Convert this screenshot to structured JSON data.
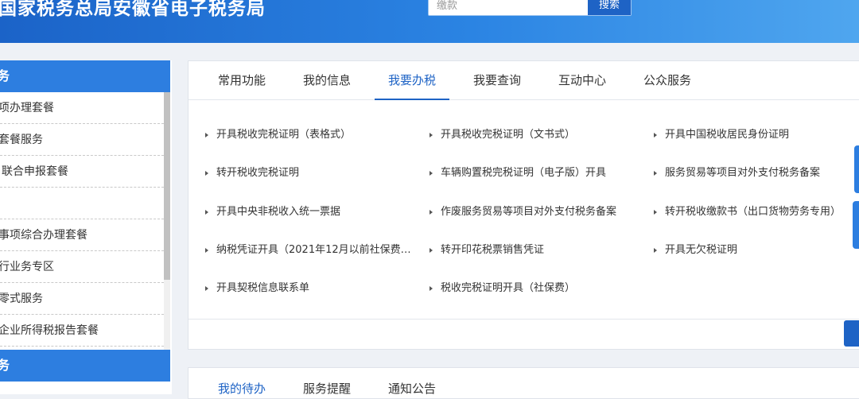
{
  "header": {
    "title": "国家税务总局安徽省电子税务局",
    "search_placeholder": "缴款",
    "search_button": "搜索"
  },
  "sidebar": {
    "head1": "务",
    "items": [
      {
        "label": "项办理套餐"
      },
      {
        "label": "套餐服务"
      },
      {
        "label": "联合申报套餐"
      },
      {
        "label": ""
      },
      {
        "label": "事项综合办理套餐"
      },
      {
        "label": "行业务专区"
      },
      {
        "label": "零式服务"
      },
      {
        "label": "企业所得税报告套餐"
      }
    ],
    "head2": "务"
  },
  "main": {
    "tabs": [
      {
        "label": "常用功能"
      },
      {
        "label": "我的信息"
      },
      {
        "label": "我要办税"
      },
      {
        "label": "我要查询"
      },
      {
        "label": "互动中心"
      },
      {
        "label": "公众服务"
      }
    ],
    "active_tab": "我要办税",
    "links": [
      {
        "label": "开具税收完税证明（表格式）"
      },
      {
        "label": "开具税收完税证明（文书式）"
      },
      {
        "label": "开具中国税收居民身份证明"
      },
      {
        "label": "转开税收完税证明"
      },
      {
        "label": "车辆购置税完税证明（电子版）开具"
      },
      {
        "label": "服务贸易等项目对外支付税务备案"
      },
      {
        "label": "开具中央非税收入统一票据"
      },
      {
        "label": "作废服务贸易等项目对外支付税务备案"
      },
      {
        "label": "转开税收缴款书（出口货物劳务专用）"
      },
      {
        "label": "纳税凭证开具（2021年12月以前社保费…"
      },
      {
        "label": "转开印花税票销售凭证"
      },
      {
        "label": "开具无欠税证明"
      },
      {
        "label": "开具契税信息联系单"
      },
      {
        "label": "税收完税证明开具（社保费）"
      }
    ]
  },
  "bottom": {
    "tabs": [
      {
        "label": "我的待办"
      },
      {
        "label": "服务提醒"
      },
      {
        "label": "通知公告"
      }
    ]
  },
  "colors": {
    "accent": "#1e63c5",
    "header": "#2b84e3",
    "sidebar_head": "#2d7ee0"
  }
}
